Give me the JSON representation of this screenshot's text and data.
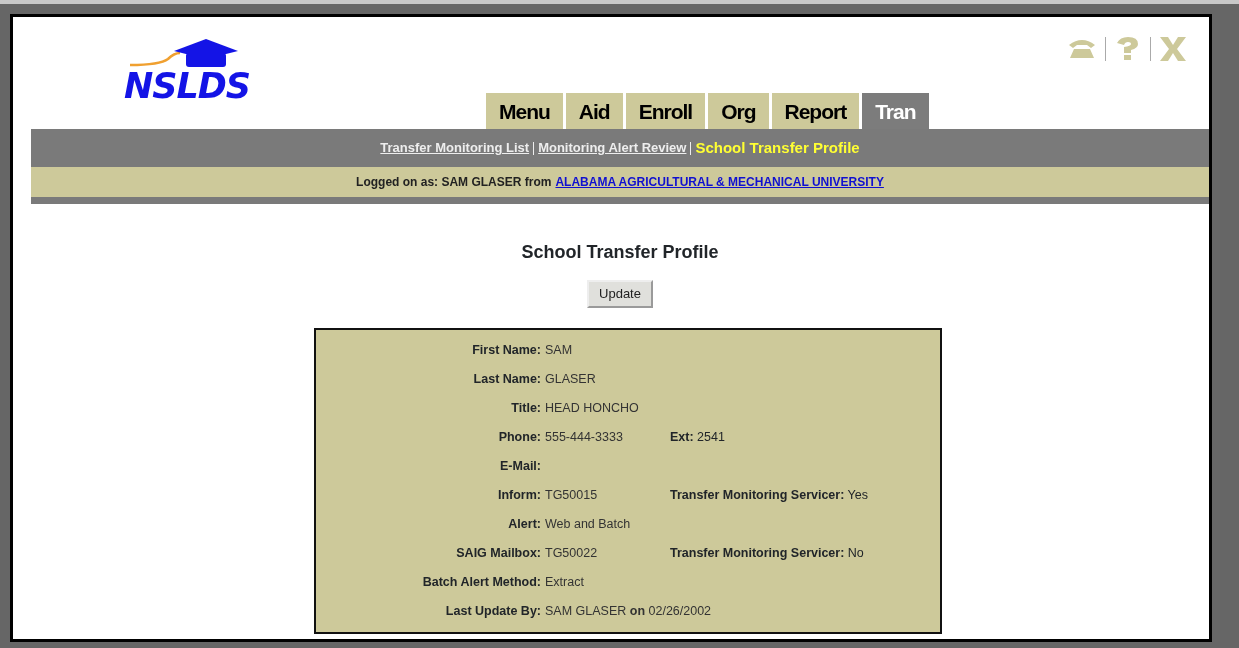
{
  "logo": {
    "text": "NSLDS"
  },
  "tabs": [
    {
      "label": "Menu",
      "selected": false
    },
    {
      "label": "Aid",
      "selected": false
    },
    {
      "label": "Enroll",
      "selected": false
    },
    {
      "label": "Org",
      "selected": false
    },
    {
      "label": "Report",
      "selected": false
    },
    {
      "label": "Tran",
      "selected": true
    }
  ],
  "subnav": [
    {
      "label": "Transfer Monitoring List",
      "selected": false
    },
    {
      "label": "Monitoring Alert Review",
      "selected": false
    },
    {
      "label": "School Transfer Profile",
      "selected": true
    }
  ],
  "login": {
    "prefix": "Logged on as: SAM GLASER from",
    "school": "ALABAMA AGRICULTURAL & MECHANICAL UNIVERSITY"
  },
  "page_title": "School Transfer Profile",
  "update_button": "Update",
  "profile": [
    {
      "label": "First Name:",
      "value": "SAM"
    },
    {
      "label": "Last Name:",
      "value": "GLASER"
    },
    {
      "label": "Title:",
      "value": "HEAD HONCHO"
    },
    {
      "label": "Phone:",
      "value": "555-444-3333",
      "extra_label": "Ext:",
      "extra_value": "2541"
    },
    {
      "label": "E-Mail:"
    },
    {
      "label": "Inform:",
      "value": "TG50015",
      "extra_label": "Transfer Monitoring Servicer:",
      "extra_value": "Yes"
    },
    {
      "label": "Alert:",
      "value": "Web and Batch"
    },
    {
      "label": "SAIG Mailbox:",
      "value": "TG50022",
      "extra_label": "Transfer Monitoring Servicer:",
      "extra_value": "No"
    },
    {
      "label": "Batch Alert Method:",
      "value": "Extract"
    },
    {
      "label": "Last Update By:",
      "value": "SAM GLASER **on** 02/26/2002"
    }
  ]
}
